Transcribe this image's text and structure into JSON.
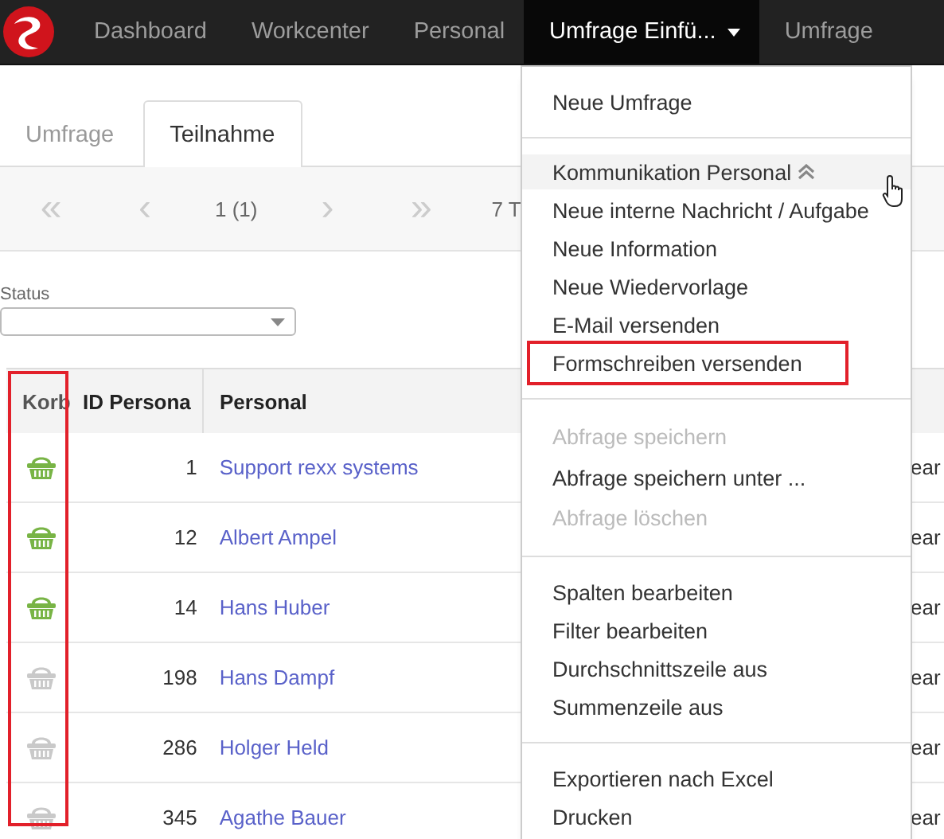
{
  "navbar": {
    "items": [
      {
        "label": "Dashboard",
        "selected": false,
        "dropdown": false
      },
      {
        "label": "Workcenter",
        "selected": false,
        "dropdown": false
      },
      {
        "label": "Personal",
        "selected": false,
        "dropdown": false
      },
      {
        "label": "Umfrage Einfü...",
        "selected": true,
        "dropdown": true
      },
      {
        "label": "Umfrage",
        "selected": false,
        "dropdown": false
      }
    ]
  },
  "tabs": [
    {
      "label": "Umfrage",
      "selected": false
    },
    {
      "label": "Teilnahme",
      "selected": true
    }
  ],
  "pager": {
    "first": "«",
    "prev": "‹",
    "page": "1 (1)",
    "next": "›",
    "last": "»",
    "count": "7 T"
  },
  "filter": {
    "label": "Status"
  },
  "table": {
    "columns": [
      {
        "label": "Korb",
        "highlighted": true
      },
      {
        "label": "ID Persona",
        "highlighted": false
      },
      {
        "label": "Personal",
        "highlighted": false
      }
    ],
    "rows": [
      {
        "in_basket": true,
        "id": "1",
        "name": "Support rexx systems",
        "column_4": "ear"
      },
      {
        "in_basket": true,
        "id": "12",
        "name": "Albert Ampel",
        "column_4": "ear"
      },
      {
        "in_basket": true,
        "id": "14",
        "name": "Hans Huber",
        "column_4": "ear"
      },
      {
        "in_basket": false,
        "id": "198",
        "name": "Hans Dampf",
        "column_4": "ear"
      },
      {
        "in_basket": false,
        "id": "286",
        "name": "Holger Held",
        "column_4": "ear"
      },
      {
        "in_basket": false,
        "id": "345",
        "name": "Agathe Bauer",
        "column_4": "ear"
      }
    ]
  },
  "menu": {
    "groups": [
      {
        "items": [
          {
            "label": "Neue Umfrage",
            "kind": "item",
            "disabled": false,
            "hovered": false,
            "highlighted": false
          }
        ]
      },
      {
        "items": [
          {
            "label": "Kommunikation Personal",
            "kind": "section",
            "disabled": false,
            "hovered": true,
            "highlighted": false
          },
          {
            "label": "Neue interne Nachricht / Aufgabe",
            "kind": "item",
            "disabled": false,
            "hovered": false,
            "highlighted": false
          },
          {
            "label": "Neue Information",
            "kind": "item",
            "disabled": false,
            "hovered": false,
            "highlighted": false
          },
          {
            "label": "Neue Wiedervorlage",
            "kind": "item",
            "disabled": false,
            "hovered": false,
            "highlighted": false
          },
          {
            "label": "E-Mail versenden",
            "kind": "item",
            "disabled": false,
            "hovered": false,
            "highlighted": false
          },
          {
            "label": "Formschreiben versenden",
            "kind": "item",
            "disabled": false,
            "hovered": false,
            "highlighted": true
          }
        ]
      },
      {
        "items": [
          {
            "label": "Abfrage speichern",
            "kind": "item",
            "disabled": true,
            "hovered": false,
            "highlighted": false
          },
          {
            "label": "Abfrage speichern unter ...",
            "kind": "item",
            "disabled": false,
            "hovered": false,
            "highlighted": false
          },
          {
            "label": "Abfrage löschen",
            "kind": "item",
            "disabled": true,
            "hovered": false,
            "highlighted": false
          }
        ]
      },
      {
        "items": [
          {
            "label": "Spalten bearbeiten",
            "kind": "item",
            "disabled": false,
            "hovered": false,
            "highlighted": false
          },
          {
            "label": "Filter bearbeiten",
            "kind": "item",
            "disabled": false,
            "hovered": false,
            "highlighted": false
          },
          {
            "label": "Durchschnittszeile aus",
            "kind": "item",
            "disabled": false,
            "hovered": false,
            "highlighted": false
          },
          {
            "label": "Summenzeile aus",
            "kind": "item",
            "disabled": false,
            "hovered": false,
            "highlighted": false
          }
        ]
      },
      {
        "items": [
          {
            "label": "Exportieren nach Excel",
            "kind": "item",
            "disabled": false,
            "hovered": false,
            "highlighted": false
          },
          {
            "label": "Drucken",
            "kind": "item",
            "disabled": false,
            "hovered": false,
            "highlighted": false
          }
        ]
      }
    ]
  }
}
